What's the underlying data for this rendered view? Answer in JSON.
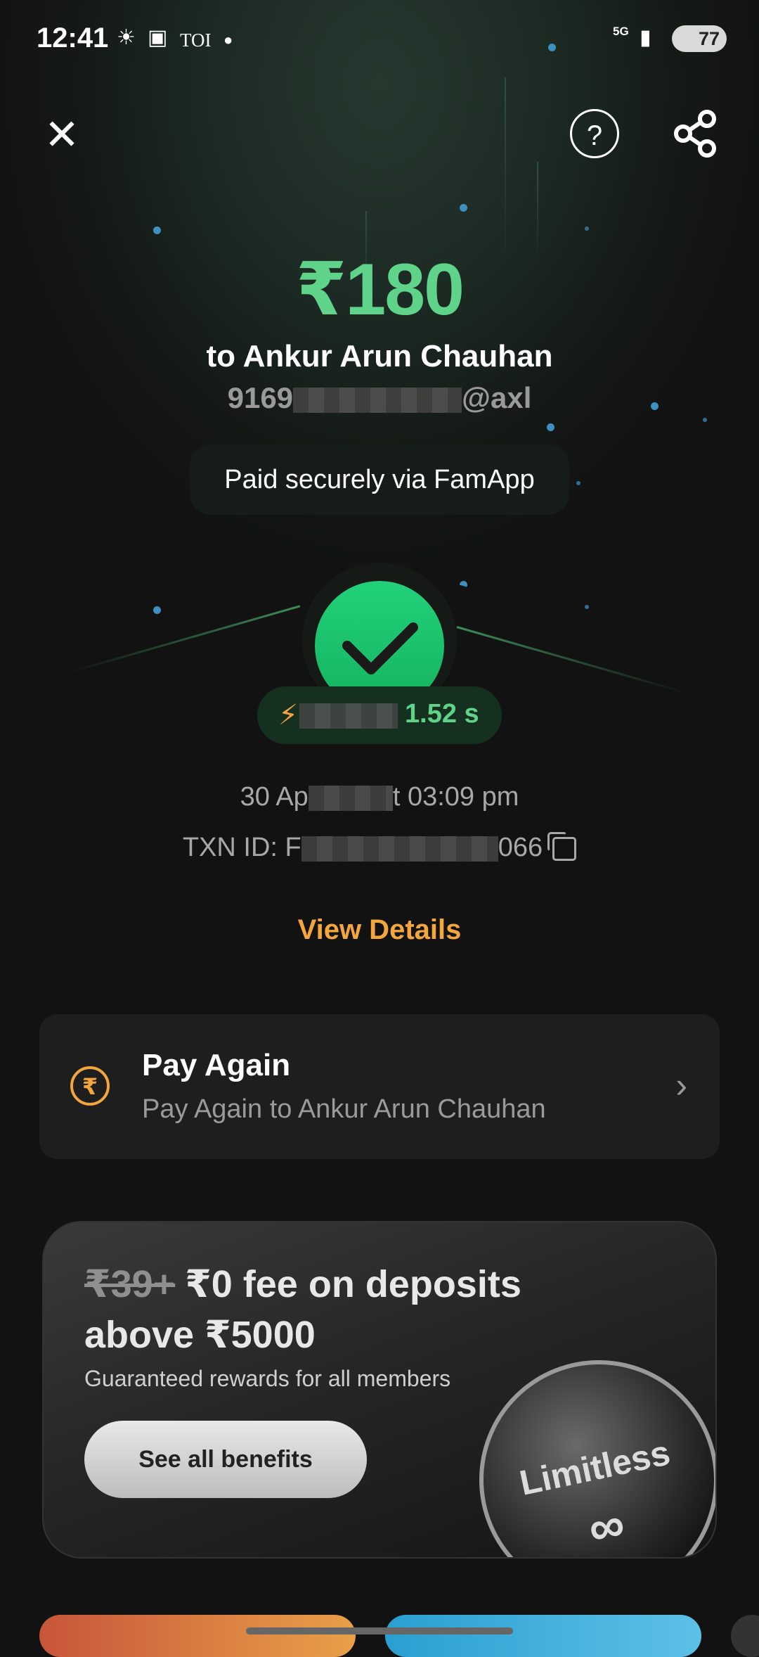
{
  "status_bar": {
    "time": "12:41",
    "toi_label": "TOI",
    "network": "5G",
    "battery": "77"
  },
  "actions": {
    "help_symbol": "?",
    "close_symbol": "✕"
  },
  "payment": {
    "amount": "₹180",
    "recipient": "to Ankur Arun Chauhan",
    "upi_prefix": "9169",
    "upi_suffix": "@axl",
    "via": "Paid securely via FamApp",
    "speed": "1.52 s",
    "date_prefix": "30 Ap",
    "date_suffix": "t 03:09 pm",
    "txn_prefix": "TXN ID: F",
    "txn_suffix": "066",
    "view_details": "View Details"
  },
  "pay_again": {
    "title": "Pay Again",
    "subtitle": "Pay Again to Ankur Arun Chauhan",
    "icon_symbol": "₹"
  },
  "promo": {
    "old_fee": "₹39+",
    "headline_part1": "₹0 fee on deposits",
    "headline_part2": "above ₹5000",
    "subtext": "Guaranteed rewards for all members",
    "button": "See all benefits",
    "coin_text": "Limitless",
    "coin_symbol": "∞"
  },
  "colors": {
    "accent_green": "#5fd38a",
    "accent_orange": "#f2a63c",
    "background": "#121212"
  }
}
